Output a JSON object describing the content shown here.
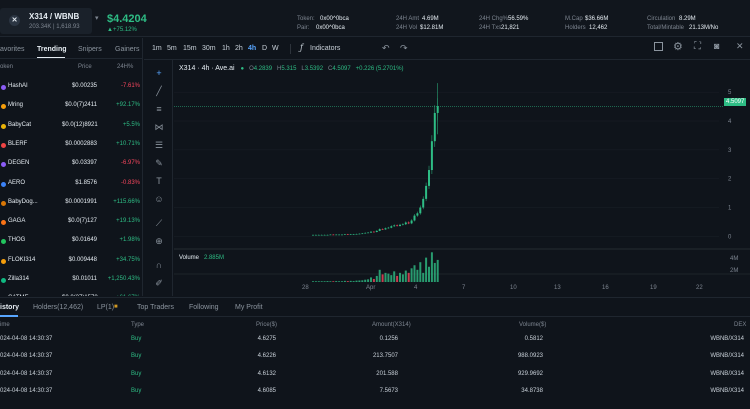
{
  "header": {
    "pair": "X314 / WBNB",
    "pair_sub": "203.34K | 1,618.93",
    "price": "$4.4204",
    "price_change": "+75.12%",
    "token_label": "Token:",
    "token_value": "0x00^0bca",
    "pair_label": "Pair:",
    "pair_value": "0x00^0bca",
    "stats": [
      {
        "label": "24H Amt",
        "value": "4.69M"
      },
      {
        "label": "24H Vol",
        "value": "$12.81M"
      },
      {
        "label": "24H Chg%",
        "value": "56.59%"
      },
      {
        "label": "24H Txs",
        "value": "21,821"
      },
      {
        "label": "M.Cap",
        "value": "$36.66M"
      },
      {
        "label": "Holders",
        "value": "12,462"
      },
      {
        "label": "Circulation",
        "value": "8.29M"
      },
      {
        "label": "Total/Mintable",
        "value": "21.13M/No"
      }
    ]
  },
  "left": {
    "tabs": [
      "avorites",
      "Trending",
      "Snipers",
      "Gainers"
    ],
    "active_tab": "Trending",
    "col_token": "oken",
    "col_price": "Price",
    "col_change": "24H%",
    "tokens": [
      {
        "name": "HashAI",
        "price": "$0.00235",
        "change": "-7.61%",
        "dir": "down",
        "color": "#8b5cf6"
      },
      {
        "name": "Mring",
        "price": "$0.0(7)2411",
        "change": "+92.17%",
        "dir": "up",
        "color": "#f59e0b"
      },
      {
        "name": "BabyCat",
        "price": "$0.0(12)8921",
        "change": "+5.5%",
        "dir": "up",
        "color": "#eab308"
      },
      {
        "name": "BLERF",
        "price": "$0.0002883",
        "change": "+10.71%",
        "dir": "up",
        "color": "#ef4444"
      },
      {
        "name": "DEGEN",
        "price": "$0.03397",
        "change": "-6.97%",
        "dir": "down",
        "color": "#8b5cf6"
      },
      {
        "name": "AERO",
        "price": "$1.8576",
        "change": "-0.83%",
        "dir": "down",
        "color": "#3b82f6"
      },
      {
        "name": "BabyDog...",
        "price": "$0.0001991",
        "change": "+115.66%",
        "dir": "up",
        "color": "#d97706"
      },
      {
        "name": "GAGA",
        "price": "$0.0(7)127",
        "change": "+19.13%",
        "dir": "up",
        "color": "#f97316"
      },
      {
        "name": "THOG",
        "price": "$0.01649",
        "change": "+1.98%",
        "dir": "up",
        "color": "#22c55e"
      },
      {
        "name": "FLOKI314",
        "price": "$0.009448",
        "change": "+34.75%",
        "dir": "up",
        "color": "#f59e0b"
      },
      {
        "name": "Zilla314",
        "price": "$0.01011",
        "change": "+1,250.43%",
        "dir": "up",
        "color": "#10b981"
      },
      {
        "name": "CATME",
        "price": "$0.0(27)1578",
        "change": "+61.67%",
        "dir": "up",
        "color": "#ec4899"
      }
    ]
  },
  "toolbar": {
    "timeframes": [
      "1m",
      "5m",
      "15m",
      "30m",
      "1h",
      "2h",
      "4h",
      "D",
      "W"
    ],
    "active_tf": "4h",
    "indicators": "Indicators"
  },
  "chart_data": {
    "type": "candlestick",
    "title": "X314 · 4h · Ave.ai",
    "ohlc": {
      "o": "4.2839",
      "h": "5.315",
      "l": "3.5392",
      "c": "4.5097",
      "chg": "+0.226 (5.2701%)"
    },
    "last_price": "4.5097",
    "y_ticks": [
      0,
      1,
      2,
      3,
      4,
      5
    ],
    "ylim": [
      -0.3,
      5.7
    ],
    "x_ticks": [
      "28",
      "Apr",
      "4",
      "7",
      "10",
      "13",
      "16",
      "19",
      "22"
    ],
    "volume_label": "Volume",
    "volume_value": "2.885M",
    "volume_ticks": [
      "4M",
      "2M"
    ],
    "closes": [
      0.05,
      0.05,
      0.05,
      0.05,
      0.05,
      0.05,
      0.06,
      0.05,
      0.06,
      0.06,
      0.06,
      0.07,
      0.06,
      0.07,
      0.07,
      0.08,
      0.09,
      0.1,
      0.12,
      0.13,
      0.16,
      0.15,
      0.19,
      0.25,
      0.24,
      0.28,
      0.3,
      0.35,
      0.38,
      0.36,
      0.4,
      0.42,
      0.48,
      0.45,
      0.55,
      0.72,
      0.8,
      1.0,
      1.3,
      1.75,
      2.3,
      3.3,
      4.28,
      4.51
    ],
    "volumes": [
      0.1,
      0.1,
      0.1,
      0.1,
      0.1,
      0.12,
      0.1,
      0.1,
      0.12,
      0.1,
      0.1,
      0.15,
      0.12,
      0.15,
      0.12,
      0.18,
      0.2,
      0.22,
      0.3,
      0.35,
      0.6,
      0.4,
      0.8,
      1.6,
      1.0,
      1.2,
      1.1,
      0.9,
      1.4,
      0.8,
      1.2,
      1.0,
      1.5,
      1.2,
      1.8,
      2.2,
      1.6,
      2.6,
      1.2,
      3.2,
      2.0,
      3.9,
      2.5,
      2.9
    ]
  },
  "bottom": {
    "tabs": [
      "istory",
      "Holders(12,462)",
      "LP(1)",
      "Top Traders",
      "Following",
      "My Profit"
    ],
    "active_tab": "istory",
    "columns": [
      "ime",
      "Type",
      "Price($)",
      "Amount(X314)",
      "Volume($)",
      "DEX"
    ],
    "rows": [
      {
        "time": "024-04-08 14:30:37",
        "type": "Buy",
        "price": "4.6275",
        "amount": "0.1256",
        "volume": "0.5812",
        "dex": "WBNB/X314"
      },
      {
        "time": "024-04-08 14:30:37",
        "type": "Buy",
        "price": "4.6226",
        "amount": "213.7507",
        "volume": "988.0923",
        "dex": "WBNB/X314"
      },
      {
        "time": "024-04-08 14:30:37",
        "type": "Buy",
        "price": "4.6132",
        "amount": "201.588",
        "volume": "929.9692",
        "dex": "WBNB/X314"
      },
      {
        "time": "024-04-08 14:30:37",
        "type": "Buy",
        "price": "4.6085",
        "amount": "7.5673",
        "volume": "34.8738",
        "dex": "WBNB/X314"
      }
    ]
  }
}
